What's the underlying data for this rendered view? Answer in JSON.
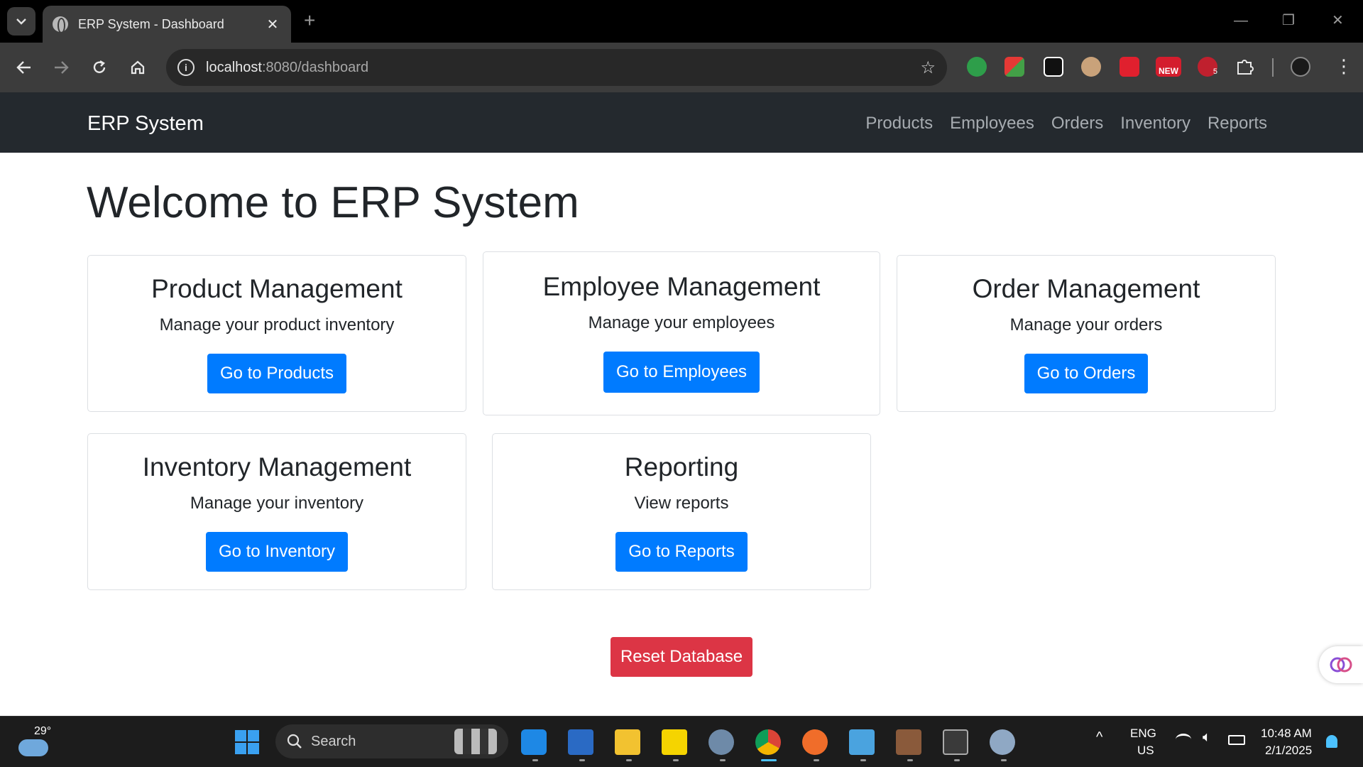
{
  "browser": {
    "tab_title": "ERP System - Dashboard",
    "tab_close": "✕",
    "new_tab": "+",
    "url_host": "localhost",
    "url_path": ":8080/dashboard",
    "extension_badges": {
      "new": "NEW",
      "count": "5"
    }
  },
  "navbar": {
    "brand": "ERP System",
    "links": [
      "Products",
      "Employees",
      "Orders",
      "Inventory",
      "Reports"
    ]
  },
  "main": {
    "title": "Welcome to ERP System",
    "cards": [
      {
        "title": "Product Management",
        "desc": "Manage your product inventory",
        "button": "Go to Products"
      },
      {
        "title": "Employee Management",
        "desc": "Manage your employees",
        "button": "Go to Employees"
      },
      {
        "title": "Order Management",
        "desc": "Manage your orders",
        "button": "Go to Orders"
      },
      {
        "title": "Inventory Management",
        "desc": "Manage your inventory",
        "button": "Go to Inventory"
      },
      {
        "title": "Reporting",
        "desc": "View reports",
        "button": "Go to Reports"
      }
    ],
    "reset_button": "Reset Database"
  },
  "colors": {
    "primary": "#007bff",
    "danger": "#dc3545",
    "navbar_bg": "#24292e"
  },
  "taskbar": {
    "weather_temp": "29°",
    "search_label": "Search",
    "lang_top": "ENG",
    "lang_bottom": "US",
    "time": "10:48 AM",
    "date": "2/1/2025"
  }
}
